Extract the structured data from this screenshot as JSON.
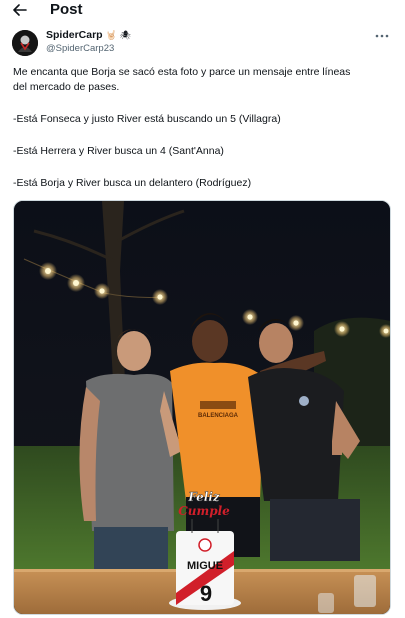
{
  "header": {
    "back_icon": "arrow-left-icon",
    "title": "Post"
  },
  "author": {
    "name": "SpiderCarp",
    "name_emojis": [
      "🤘🏻",
      "🕷"
    ],
    "handle": "@SpiderCarp23",
    "avatar_icon": "spider-avatar-icon"
  },
  "more_icon": "more-horizontal-icon",
  "post": {
    "lines": [
      "Me encanta que Borja se sacó esta foto y parce un mensaje entre líneas",
      "del mercado de pases.",
      "-Está Fonseca y justo River está buscando un 5 (Villagra)",
      "-Está Herrera y River busca un 4 (Sant'Anna)",
      "-Está Borja y River busca un delantero (Rodríguez)"
    ]
  },
  "photo": {
    "cake_topper_line1": "Feliz",
    "cake_topper_line2": "Cumple",
    "cake_name": "MIGUE",
    "cake_number": "9",
    "shirt_text": "BALENCIAGA"
  },
  "colors": {
    "text": "#0f1419",
    "secondary": "#536471",
    "border": "#cfd9de",
    "shirt_orange": "#f0902a",
    "river_red": "#d11f2a"
  }
}
